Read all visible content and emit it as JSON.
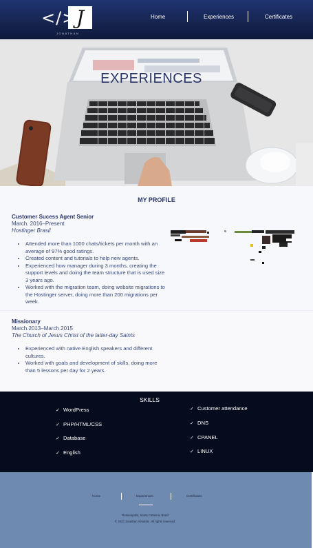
{
  "header": {
    "logo_code": "</>",
    "logo_letter": "J",
    "logo_name": "JONATHAN",
    "nav": [
      "Home",
      "Experiences",
      "Certificates"
    ]
  },
  "hero": {
    "title": "EXPERIENCES"
  },
  "profile": {
    "title": "MY PROFILE",
    "jobs": [
      {
        "title": "Customer Sucess Agent Senior",
        "date": "March. 2016–Present",
        "company": "Hostinger Brasil",
        "bullets": [
          "Attended more than 1000 chats/tickets per month with an average of 97% good ratings.",
          "Created content and tutorials to help new agents.",
          "Experienced how manager during 3 months, creating the support levels and doing the team structure that is used size 3 years ago.",
          "Worked with the migration team, doing website migrations to the Hostinger server, doing more than 200 migrations per week."
        ]
      },
      {
        "title": "Missionary",
        "date": "March.2013–March.2015",
        "company": "The Church of Jesus Christ of the latter-day Saints",
        "bullets": [
          "Experienced with native English speakers and different cultures.",
          "Worked with goals and development of skills, doing more than 5 lessons per day for 2 years."
        ]
      }
    ]
  },
  "skills": {
    "title": "SKILLS",
    "left": [
      "WordPress",
      "PHP/HTML/CSS",
      "Database",
      "English"
    ],
    "right": [
      "Customer attendance",
      "DNS",
      "CPANEL",
      "LINUX"
    ]
  },
  "footer": {
    "nav": [
      "Home",
      "Experiences",
      "Certificates"
    ],
    "address": "Florianópolis, Santa Catarina, Brazil",
    "copyright": "© 2023 Jonathan Almeida . All rights reserved."
  },
  "colors": {
    "header": "#16244f",
    "accent_text": "#2b3668",
    "skills_bg": "#050c1e",
    "footer_bg": "#6f8ab0"
  }
}
